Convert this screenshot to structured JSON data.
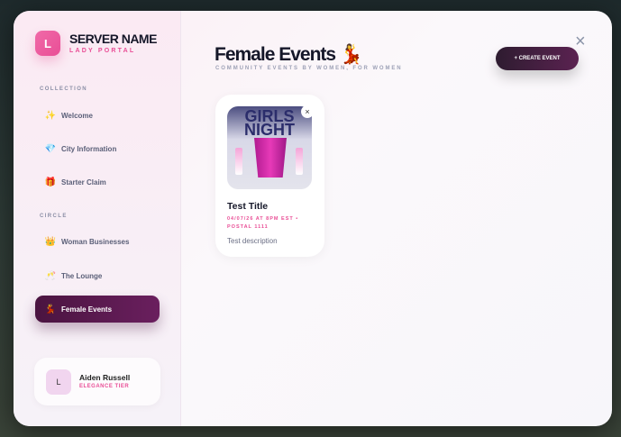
{
  "sidebar": {
    "logo_letter": "L",
    "server_name": "SERVER NAME",
    "subtitle": "LADY PORTAL",
    "sections": [
      {
        "label": "COLLECTION",
        "items": [
          {
            "label": "Welcome",
            "icon": "✨"
          },
          {
            "label": "City Information",
            "icon": "💎"
          },
          {
            "label": "Starter Claim",
            "icon": "🎁"
          }
        ]
      },
      {
        "label": "CIRCLE",
        "items": [
          {
            "label": "Woman Businesses",
            "icon": "👑"
          },
          {
            "label": "The Lounge",
            "icon": "🥂"
          },
          {
            "label": "Female Events",
            "icon": "💃",
            "active": true
          }
        ]
      }
    ],
    "user": {
      "avatar_letter": "L",
      "name": "Aiden Russell",
      "tier": "ELEGANCE TIER"
    }
  },
  "main": {
    "title": "Female Events 💃",
    "subtitle": "COMMUNITY EVENTS BY WOMEN, FOR WOMEN",
    "create_label": "+ CREATE EVENT",
    "close_icon": "×",
    "events": [
      {
        "image_text": "GIRLS NIGHT",
        "title": "Test Title",
        "meta": "04/07/26 AT 8PM EST • POSTAL 1111",
        "description": "Test description",
        "remove_icon": "×"
      }
    ]
  },
  "colors": {
    "accent": "#e94e96",
    "active": "#5b1a50"
  }
}
